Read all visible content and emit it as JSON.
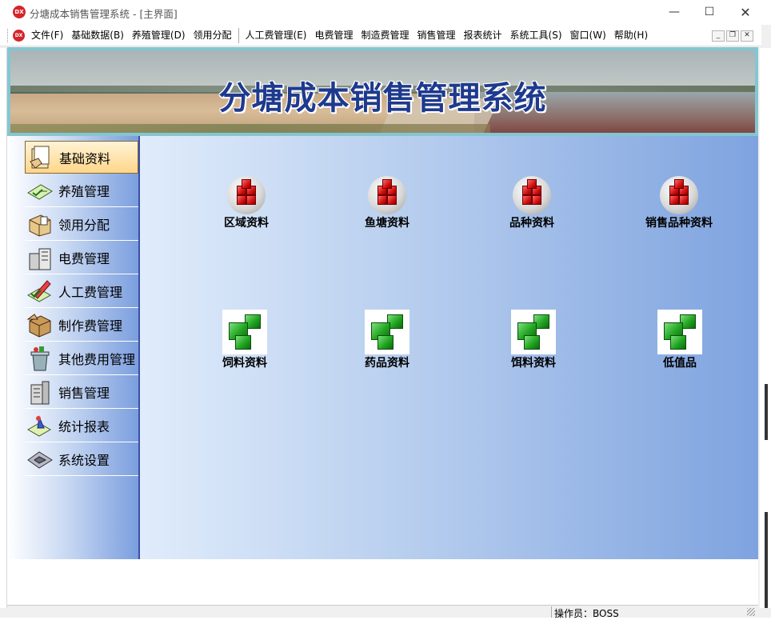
{
  "window": {
    "title": "分塘成本销售管理系统 - [主界面]",
    "app_icon_text": "DX",
    "minimize": "—",
    "maximize": "☐",
    "close": "✕"
  },
  "menu": {
    "items": [
      {
        "label": "文件(F)"
      },
      {
        "label": "基础数据(B)"
      },
      {
        "label": "养殖管理(D)"
      },
      {
        "label": "领用分配"
      },
      {
        "label": "人工费管理(E)"
      },
      {
        "label": "电费管理"
      },
      {
        "label": "制造费管理"
      },
      {
        "label": "销售管理"
      },
      {
        "label": "报表统计"
      },
      {
        "label": "系统工具(S)"
      },
      {
        "label": "窗口(W)"
      },
      {
        "label": "帮助(H)"
      }
    ],
    "mdi": {
      "minimize": "_",
      "restore": "❐",
      "close": "✕"
    }
  },
  "banner": {
    "title": "分塘成本销售管理系统"
  },
  "sidebar": {
    "items": [
      {
        "label": "基础资料",
        "icon": "folder-hand-icon",
        "active": true
      },
      {
        "label": "养殖管理",
        "icon": "checklist-icon"
      },
      {
        "label": "领用分配",
        "icon": "box-open-icon"
      },
      {
        "label": "电费管理",
        "icon": "buildings-icon"
      },
      {
        "label": "人工费管理",
        "icon": "pencil-check-icon"
      },
      {
        "label": "制作费管理",
        "icon": "package-icon"
      },
      {
        "label": "其他费用管理",
        "icon": "bin-icon"
      },
      {
        "label": "销售管理",
        "icon": "building-icon"
      },
      {
        "label": "统计报表",
        "icon": "chart-icon"
      },
      {
        "label": "系统设置",
        "icon": "system-icon"
      }
    ]
  },
  "main": {
    "row1": [
      {
        "label": "区域资料",
        "icon": "red-cubes-icon"
      },
      {
        "label": "鱼塘资料",
        "icon": "red-cubes-icon"
      },
      {
        "label": "品种资料",
        "icon": "red-cubes-icon"
      },
      {
        "label": "销售品种资料",
        "icon": "red-cubes-icon"
      }
    ],
    "row2": [
      {
        "label": "饲料资料",
        "icon": "green-blocks-icon"
      },
      {
        "label": "药品资料",
        "icon": "green-blocks-icon"
      },
      {
        "label": "饵料资料",
        "icon": "green-blocks-icon"
      },
      {
        "label": "低值品",
        "icon": "green-blocks-icon"
      }
    ]
  },
  "status": {
    "operator": "操作员：BOSS"
  },
  "colors": {
    "accent_blue": "#1e3a8e",
    "sidebar_border": "#3b4fa6",
    "active_item": "#ffd68a",
    "cube_red": "#d41010",
    "block_green": "#22a622"
  }
}
